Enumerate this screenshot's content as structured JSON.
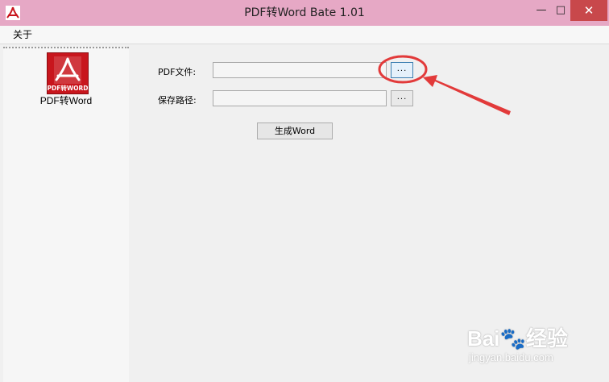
{
  "window": {
    "title": "PDF转Word Bate 1.01",
    "minimize_glyph": "—",
    "maximize_glyph": "□",
    "close_glyph": "✕"
  },
  "menu": {
    "items": [
      {
        "label": "关于"
      }
    ]
  },
  "sidebar": {
    "tools": [
      {
        "label": "PDF转Word",
        "icon_caption": "PDF转WORD",
        "icon": "pdf-word-icon"
      }
    ]
  },
  "form": {
    "pdf_label": "PDF文件:",
    "pdf_value": "",
    "pdf_browse_label": "...",
    "save_label": "保存路径:",
    "save_value": "",
    "save_browse_label": "...",
    "generate_label": "生成Word"
  },
  "watermark": {
    "logo": "Bai🐾经验",
    "url": "jingyan.baidu.com"
  },
  "colors": {
    "titlebar": "#e6a8c5",
    "close": "#c8484b",
    "annotation": "#e23a3a",
    "icon_red": "#c8161d"
  }
}
